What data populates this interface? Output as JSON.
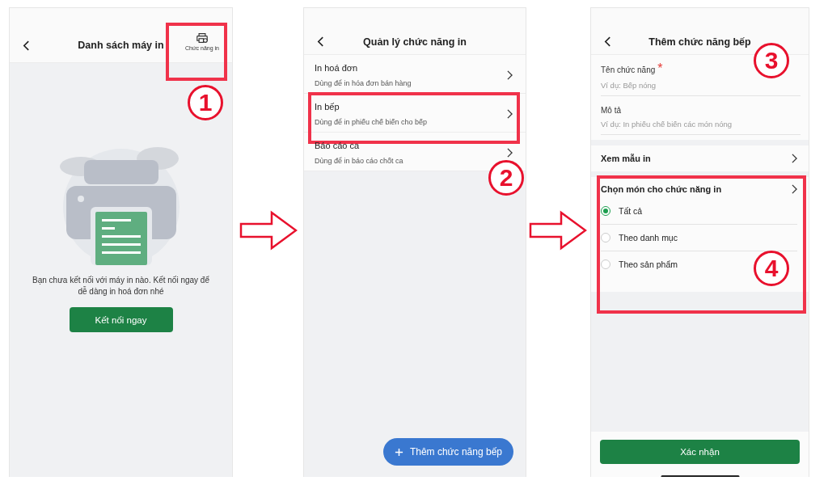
{
  "screens": [
    {
      "kind": "printer_list",
      "title": "Danh sách máy in",
      "action": {
        "label": "Chức năng in",
        "highlighted": true
      },
      "message": "Bạn chưa kết nối với máy in nào. Kết nối ngay để dễ dàng in hoá đơn nhé",
      "button": "Kết nối ngay",
      "callouts": [
        "1"
      ]
    },
    {
      "kind": "function_list",
      "title": "Quản lý chức năng in",
      "items": [
        {
          "name": "In hoá đơn",
          "description": "Dùng để in hóa đơn bán hàng",
          "highlighted": false
        },
        {
          "name": "In bếp",
          "description": "Dùng để in phiếu chế biến cho bếp",
          "highlighted": true
        },
        {
          "name": "Báo cáo ca",
          "description": "Dùng để in báo cáo chốt ca",
          "highlighted": false
        }
      ],
      "fab": "Thêm chức năng bếp",
      "callouts": [
        "2"
      ]
    },
    {
      "kind": "add_form",
      "title": "Thêm chức năng bếp",
      "fields": [
        {
          "label": "Tên chức năng",
          "required_mark": "*",
          "placeholder": "Ví dụ: Bếp nóng"
        },
        {
          "label": "Mô tả",
          "placeholder": "Ví dụ: In phiếu chế biến các món nóng"
        }
      ],
      "preview_row": "Xem mẫu in",
      "choice": {
        "title": "Chọn món cho chức năng in",
        "highlighted": true,
        "options": [
          {
            "label": "Tất cả",
            "selected": true
          },
          {
            "label": "Theo danh mục",
            "selected": false
          },
          {
            "label": "Theo sản phẩm",
            "selected": false
          }
        ]
      },
      "confirm": "Xác nhận",
      "callouts": [
        "3",
        "4"
      ]
    }
  ]
}
